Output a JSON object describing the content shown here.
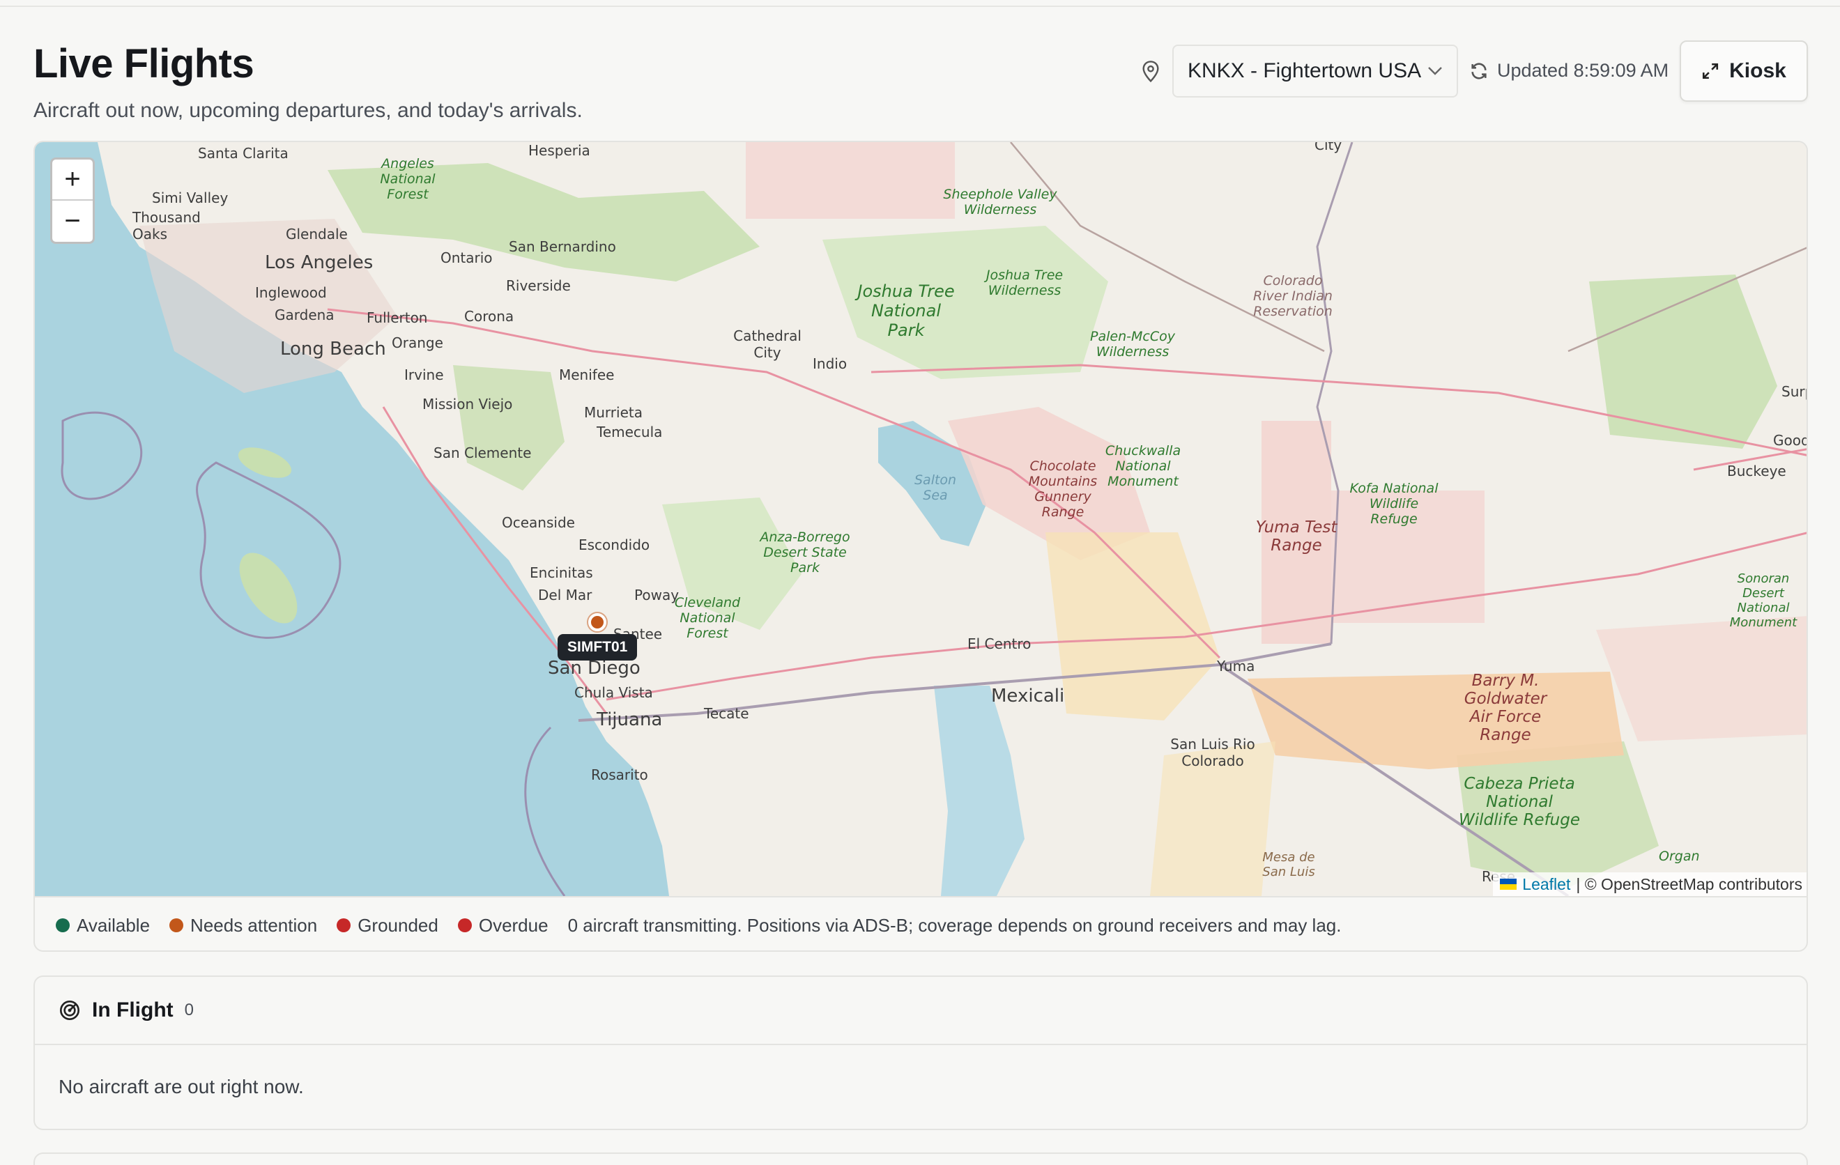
{
  "header": {
    "title": "Live Flights",
    "subtitle": "Aircraft out now, upcoming departures, and today's arrivals.",
    "airport_select": "KNKX - Fightertown USA",
    "updated": "Updated 8:59:09 AM",
    "kiosk_label": "Kiosk"
  },
  "map": {
    "zoom_in": "+",
    "zoom_out": "−",
    "aircraft": [
      {
        "callsign": "SIMFT01",
        "status": "needs-attention"
      }
    ],
    "place_labels": {
      "hesperia": "Hesperia",
      "santa_clarita": "Santa Clarita",
      "simi_valley": "Simi Valley",
      "thousand_oaks": "Thousand Oaks",
      "angeles_nf": "Angeles National Forest",
      "glendale": "Glendale",
      "los_angeles": "Los Angeles",
      "ontario": "Ontario",
      "san_bernardino": "San Bernardino",
      "riverside": "Riverside",
      "inglewood": "Inglewood",
      "gardena": "Gardena",
      "fullerton": "Fullerton",
      "corona": "Corona",
      "long_beach": "Long Beach",
      "orange": "Orange",
      "irvine": "Irvine",
      "menifee": "Menifee",
      "mission_viejo": "Mission Viejo",
      "murrieta": "Murrieta",
      "temecula": "Temecula",
      "san_clemente": "San Clemente",
      "oceanside": "Oceanside",
      "escondido": "Escondido",
      "encinitas": "Encinitas",
      "del_mar": "Del Mar",
      "poway": "Poway",
      "santee": "Santee",
      "san_diego": "San Diego",
      "chula_vista": "Chula Vista",
      "tijuana": "Tijuana",
      "tecate": "Tecate",
      "rosarito": "Rosarito",
      "cleveland_nf": "Cleveland National Forest",
      "anza_borrego": "Anza-Borrego Desert State Park",
      "cathedral_city": "Cathedral City",
      "indio": "Indio",
      "salton_sea": "Salton Sea",
      "joshua_tree": "Joshua Tree National Park",
      "joshua_tree_wild": "Joshua Tree Wilderness",
      "sheephole": "Sheephole Valley Wilderness",
      "palen_mccoy": "Palen-McCoy Wilderness",
      "chocolate_mtns": "Chocolate Mountains Gunnery Range",
      "chuckwalla": "Chuckwalla National Monument",
      "colorado_river": "Colorado River Indian Reservation",
      "yuma_test": "Yuma Test Range",
      "kofa": "Kofa National Wildlife Refuge",
      "el_centro": "El Centro",
      "mexicali": "Mexicali",
      "yuma": "Yuma",
      "san_luis": "San Luis Rio Colorado",
      "barry_goldwater": "Barry M. Goldwater Air Force Range",
      "cabeza_prieta": "Cabeza Prieta National Wildlife Refuge",
      "sonoran": "Sonoran Desert National Monument",
      "buckeye": "Buckeye",
      "goodyear": "Good",
      "surprise": "Surp",
      "mesa_de_san_luis": "Mesa de San Luis",
      "organ": "Organ",
      "city": "City",
      "rese": "Rese"
    },
    "attribution_leaflet": "Leaflet",
    "attribution_osm": "| © OpenStreetMap contributors"
  },
  "legend": {
    "items": [
      {
        "label": "Available",
        "color": "#166c4e"
      },
      {
        "label": "Needs attention",
        "color": "#c2571a"
      },
      {
        "label": "Grounded",
        "color": "#c62828"
      },
      {
        "label": "Overdue",
        "color": "#c62828"
      }
    ],
    "note": "0 aircraft transmitting. Positions via ADS-B; coverage depends on ground receivers and may lag."
  },
  "in_flight": {
    "title": "In Flight",
    "count": "0",
    "empty_message": "No aircraft are out right now."
  },
  "colors": {
    "water": "#aad3df",
    "land": "#f2efe9",
    "park": "#c8dfb0",
    "military": "#f3d3cf",
    "needs_attention": "#c2571a"
  }
}
